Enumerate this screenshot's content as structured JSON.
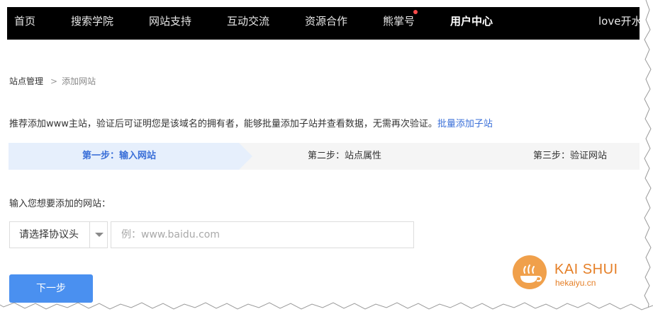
{
  "nav": {
    "items": [
      "首页",
      "搜索学院",
      "网站支持",
      "互动交流",
      "资源合作",
      "熊掌号",
      "用户中心"
    ],
    "user_name": "love开水"
  },
  "breadcrumb": {
    "parent": "站点管理",
    "separator": ">",
    "current": "添加网站"
  },
  "tip": {
    "text": "推荐添加www主站，验证后可证明您是该域名的拥有者，能够批量添加子站并查看数据，无需再次验证。",
    "link": "批量添加子站"
  },
  "steps": [
    "第一步：输入网站",
    "第二步：站点属性",
    "第三步：验证网站"
  ],
  "form": {
    "label": "输入您想要添加的网站：",
    "protocol_selected": "请选择协议头",
    "url_placeholder": "例：www.baidu.com",
    "url_value": ""
  },
  "next_button": "下一步",
  "watermark": {
    "title": "KAI SHUI",
    "subtitle": "hekaiyu.cn",
    "logo_text": "开水"
  },
  "colors": {
    "accent": "#3a6fd8",
    "button": "#4a90f0",
    "nav_bg": "#000000",
    "watermark": "#e57f27",
    "dot": "#ff4b4b"
  }
}
